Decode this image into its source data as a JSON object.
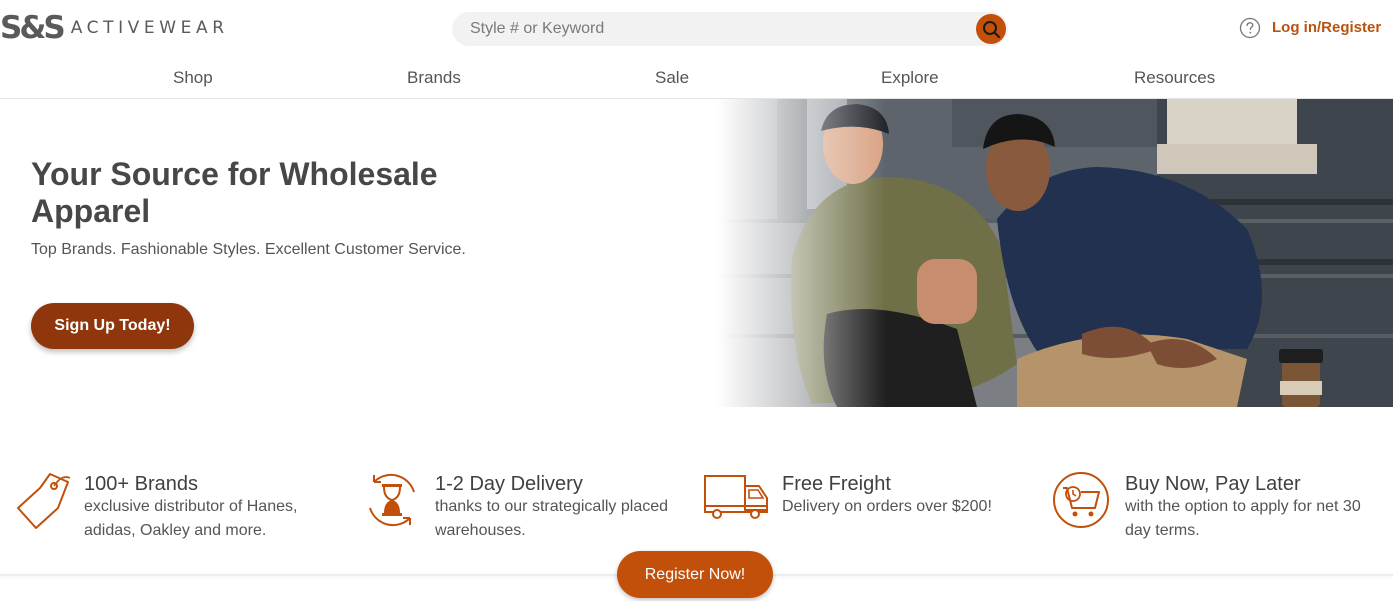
{
  "brand": {
    "logo_mark": "S&S",
    "logo_word": "ACTIVEWEAR"
  },
  "header": {
    "search": {
      "placeholder": "Style # or Keyword",
      "icon": "search-icon"
    },
    "help_icon": "help-circle-icon",
    "login_label": "Log in/Register"
  },
  "nav": {
    "items": [
      "Shop",
      "Brands",
      "Sale",
      "Explore",
      "Resources"
    ]
  },
  "hero": {
    "title": "Your Source for Wholesale Apparel",
    "subtitle": "Top Brands. Fashionable Styles. Excellent Customer Service.",
    "cta_label": "Sign Up Today!"
  },
  "features": [
    {
      "icon": "price-tag-icon",
      "title": "100+ Brands",
      "description": "exclusive distributor of Hanes, adidas, Oakley and more."
    },
    {
      "icon": "hourglass-icon",
      "title": "1-2 Day Delivery",
      "description": "thanks to our strategically placed warehouses."
    },
    {
      "icon": "truck-icon",
      "title": "Free Freight",
      "description": "Delivery on orders over $200!"
    },
    {
      "icon": "cart-clock-icon",
      "title": "Buy Now, Pay Later",
      "description": "with the option to apply for net 30 day terms."
    }
  ],
  "register_label": "Register Now!",
  "colors": {
    "accent": "#c2500b",
    "accent_dark": "#8f360c",
    "link": "#b85411",
    "text": "#474747"
  }
}
